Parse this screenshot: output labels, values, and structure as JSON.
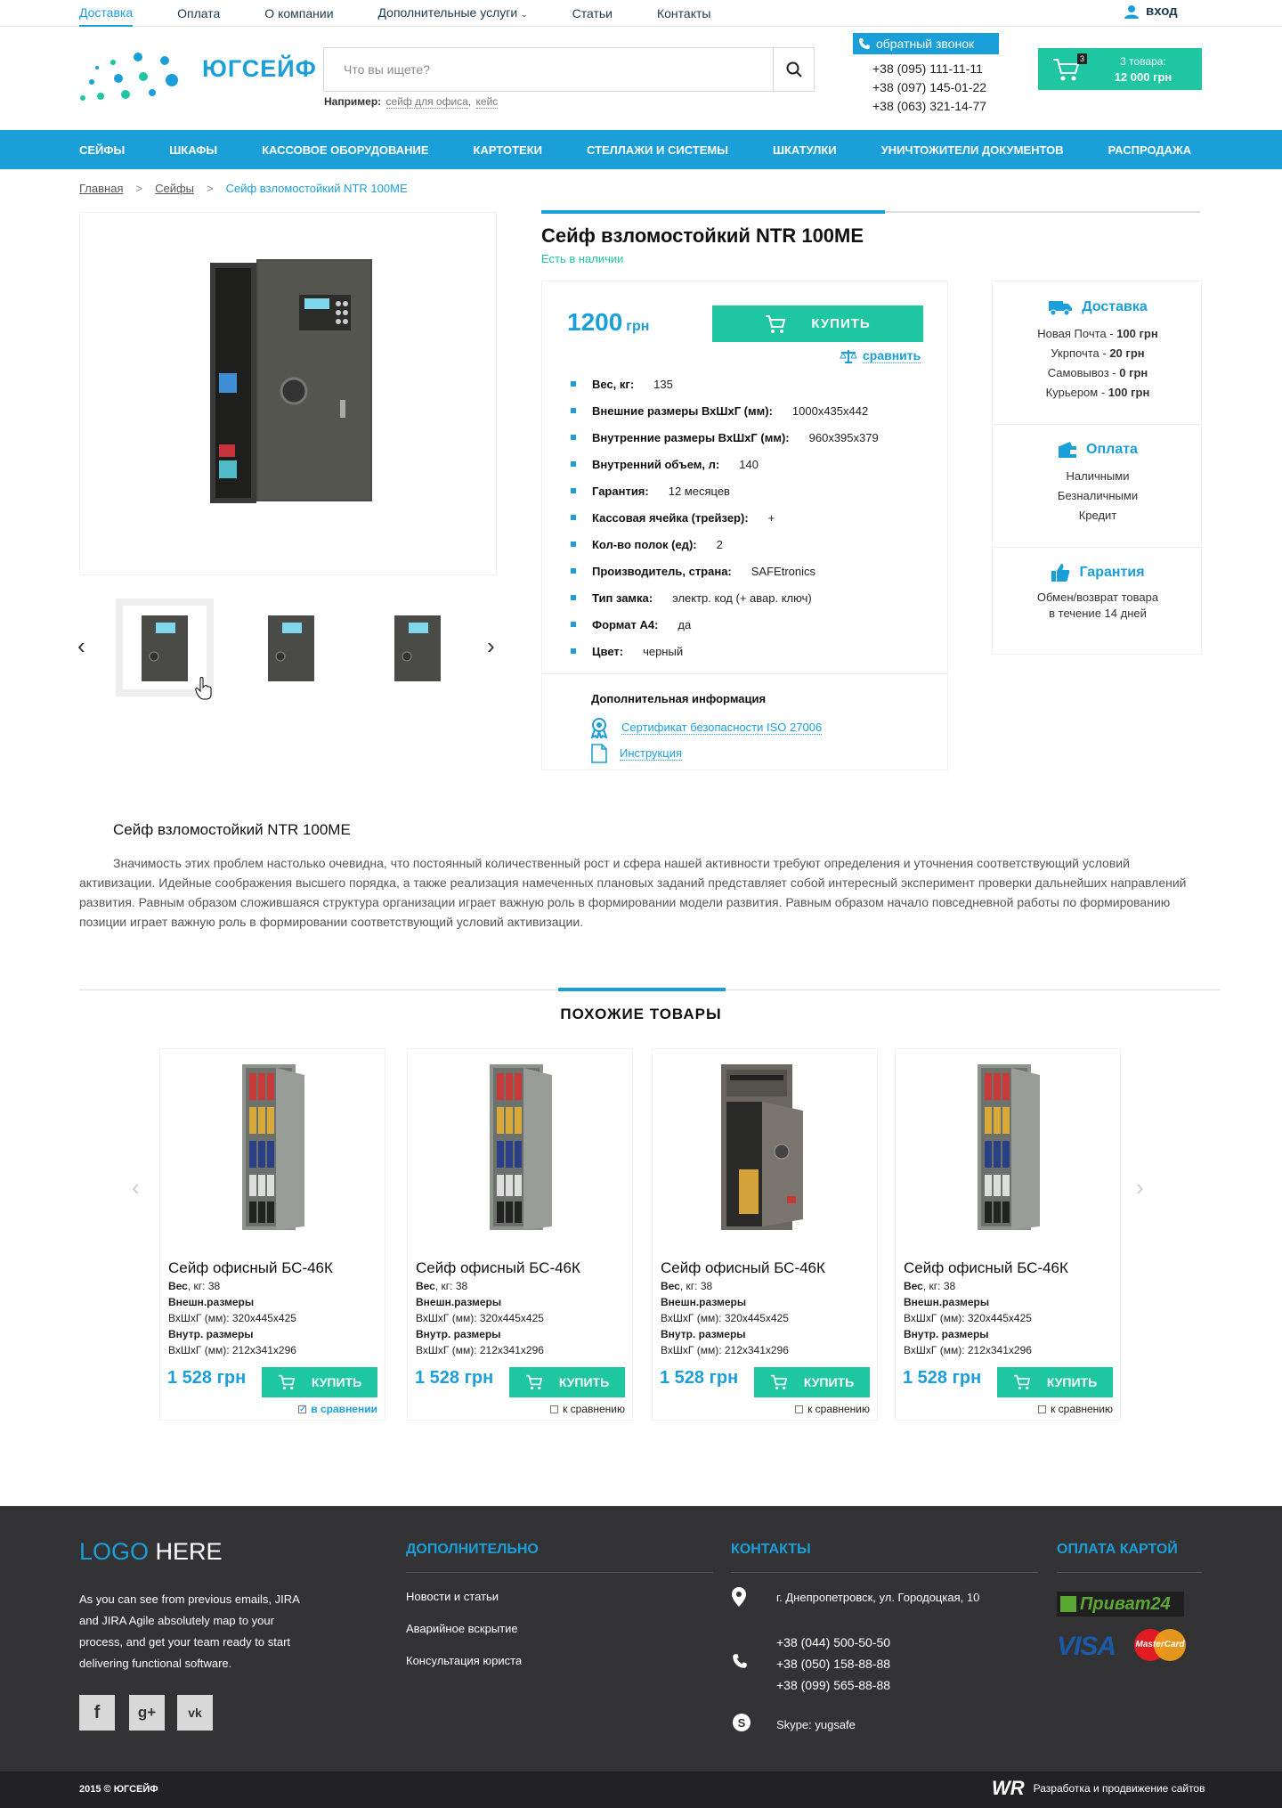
{
  "topnav": {
    "items": [
      "Доставка",
      "Оплата",
      "О компании",
      "Дополнительные услуги",
      "Статьи",
      "Контакты"
    ],
    "login": "вход"
  },
  "header": {
    "logo_text": "ЮГСЕЙФ",
    "search_placeholder": "Что вы ищете?",
    "hint_label": "Например:",
    "hint_links": [
      "сейф для офиса",
      "кейс"
    ],
    "callback": "обратный звонок",
    "phones": [
      "+38 (095) 111-11-11",
      "+38 (097) 145-01-22",
      "+38 (063) 321-14-77"
    ],
    "cart_count": "3",
    "cart_items": "3 товара:",
    "cart_total": "12 000 грн"
  },
  "mainnav": [
    "Сейфы",
    "Шкафы",
    "Кассовое оборудование",
    "Картотеки",
    "Стеллажи и системы",
    "Шкатулки",
    "Уничтожители документов",
    "Распродажа"
  ],
  "breadcrumb": {
    "home": "Главная",
    "section": "Сейфы",
    "current": "Сейф взломостойкий NTR 100ME"
  },
  "product": {
    "title": "Сейф взломостойкий NTR 100ME",
    "stock": "Есть в наличии",
    "price": "1200",
    "currency": "грн",
    "buy": "КУПИТЬ",
    "compare": "сравнить",
    "specs": [
      {
        "k": "Вес, кг:",
        "v": "135"
      },
      {
        "k": "Внешние размеры ВхШхГ (мм):",
        "v": "1000x435x442"
      },
      {
        "k": "Внутренние размеры ВхШхГ (мм):",
        "v": "960x395x379"
      },
      {
        "k": "Внутренний объем, л:",
        "v": "140"
      },
      {
        "k": "Гарантия:",
        "v": "12 месяцев"
      },
      {
        "k": "Кассовая ячейка (трейзер):",
        "v": "+"
      },
      {
        "k": "Кол-во полок (ед):",
        "v": "2"
      },
      {
        "k": "Производитель, страна:",
        "v": "SAFEtronics"
      },
      {
        "k": "Тип замка:",
        "v": "электр. код (+ авар. ключ)"
      },
      {
        "k": "Формат А4:",
        "v": "да"
      },
      {
        "k": "Цвет:",
        "v": "черный"
      }
    ],
    "add_info_title": "Дополнительная информация",
    "certificate": "Сертификат безопасности ISO 27006",
    "manual": "Инструкция"
  },
  "sidebar": {
    "delivery_title": "Доставка",
    "delivery": [
      {
        "name": "Новая Почта - ",
        "price": "100 грн"
      },
      {
        "name": "Укрпочта - ",
        "price": "20 грн"
      },
      {
        "name": "Самовывоз - ",
        "price": "0 грн"
      },
      {
        "name": "Курьером - ",
        "price": "100 грн"
      }
    ],
    "payment_title": "Оплата",
    "payment": [
      "Наличными",
      "Безналичными",
      "Кредит"
    ],
    "warranty_title": "Гарантия",
    "warranty_1": "Обмен/возврат товара",
    "warranty_2": "в течение 14 дней"
  },
  "description": {
    "title": "Сейф взломостойкий NTR 100ME",
    "text": "Значимость этих проблем настолько очевидна, что постоянный количественный рост и сфера нашей активности требуют определения и уточнения соответствующий условий активизации. Идейные соображения высшего порядка, а также реализация намеченных плановых заданий представляет собой интересный эксперимент проверки дальнейших направлений развития. Равным образом сложившаяся структура организации играет важную роль в формировании модели развития. Равным образом начало повседневной работы по формированию позиции играет важную роль в формировании соответствующий условий активизации."
  },
  "similar": {
    "title": "ПОХОЖИЕ ТОВАРЫ",
    "items": [
      {
        "name": "Сейф офисный БС-46К",
        "weight_label": "Вес",
        "weight": ", кг: 38",
        "ext_label": "Внешн.размеры",
        "ext": "ВхШхГ (мм): 320x445x425",
        "int_label": "Внутр. размеры",
        "int": "ВхШхГ (мм): 212x341x296",
        "price": "1 528 грн",
        "buy": "КУПИТЬ",
        "compare": "в сравнении",
        "compared": true
      },
      {
        "name": "Сейф офисный БС-46К",
        "weight_label": "Вес",
        "weight": ", кг: 38",
        "ext_label": "Внешн.размеры",
        "ext": "ВхШхГ (мм): 320x445x425",
        "int_label": "Внутр. размеры",
        "int": "ВхШхГ (мм): 212x341x296",
        "price": "1 528 грн",
        "buy": "КУПИТЬ",
        "compare": "к сравнению",
        "compared": false
      },
      {
        "name": "Сейф офисный БС-46К",
        "weight_label": "Вес",
        "weight": ", кг: 38",
        "ext_label": "Внешн.размеры",
        "ext": "ВхШхГ (мм): 320x445x425",
        "int_label": "Внутр. размеры",
        "int": "ВхШхГ (мм): 212x341x296",
        "price": "1 528 грн",
        "buy": "КУПИТЬ",
        "compare": "к сравнению",
        "compared": false
      },
      {
        "name": "Сейф офисный БС-46К",
        "weight_label": "Вес",
        "weight": ", кг: 38",
        "ext_label": "Внешн.размеры",
        "ext": "ВхШхГ (мм): 320x445x425",
        "int_label": "Внутр. размеры",
        "int": "ВхШхГ (мм): 212x341x296",
        "price": "1 528 грн",
        "buy": "КУПИТЬ",
        "compare": "к сравнению",
        "compared": false
      }
    ]
  },
  "footer": {
    "logo_a": "LOGO",
    "logo_b": "HERE",
    "about": "As you can see from previous emails, JIRA and JIRA Agile absolutely map to your process, and get your team ready to start delivering functional software.",
    "col2_title": "ДОПОЛНИТЕЛЬНО",
    "links": [
      "Новости и статьи",
      "Аварийное вскрытие",
      "Консультация юриста"
    ],
    "col3_title": "КОНТАКТЫ",
    "address": "г. Днепропетровск, ул. Городоцкая, 10",
    "phones": [
      "+38 (044) 500-50-50",
      "+38 (050) 158-88-88",
      "+38 (099) 565-88-88"
    ],
    "skype": "Skype:  yugsafe",
    "col4_title": "ОПЛАТА КАРТОЙ",
    "privat": "Приват24",
    "visa": "VISA",
    "mastercard": "MasterCard",
    "copyright": "2015 © ЮГСЕЙФ",
    "dev_logo": "WR",
    "dev_text": "Разработка и продвижение сайтов"
  },
  "colors": {
    "accent": "#1a9fd9",
    "green": "#1ec6a1",
    "footer_bg": "#333335"
  }
}
